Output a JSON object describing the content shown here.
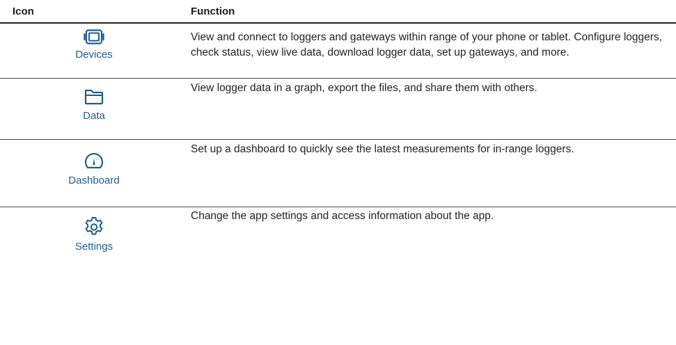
{
  "table": {
    "header": {
      "icon": "Icon",
      "function": "Function"
    },
    "rows": [
      {
        "icon": "devices-icon",
        "label": "Devices",
        "description": "View and connect to loggers and gateways within range of your phone or tablet. Configure loggers, check status, view live data, download logger data, set up gateways, and more."
      },
      {
        "icon": "folder-icon",
        "label": "Data",
        "description": "View logger data in a graph, export the files, and share them with others."
      },
      {
        "icon": "gauge-icon",
        "label": "Dashboard",
        "description": "Set up a dashboard to quickly see the latest measurements for in-range loggers."
      },
      {
        "icon": "gear-icon",
        "label": "Settings",
        "description": "Change the app settings and access information about the app."
      }
    ]
  },
  "colors": {
    "icon": "#1f5c8d",
    "label": "#1f5c8d",
    "text": "#222222",
    "rule": "#444444"
  }
}
